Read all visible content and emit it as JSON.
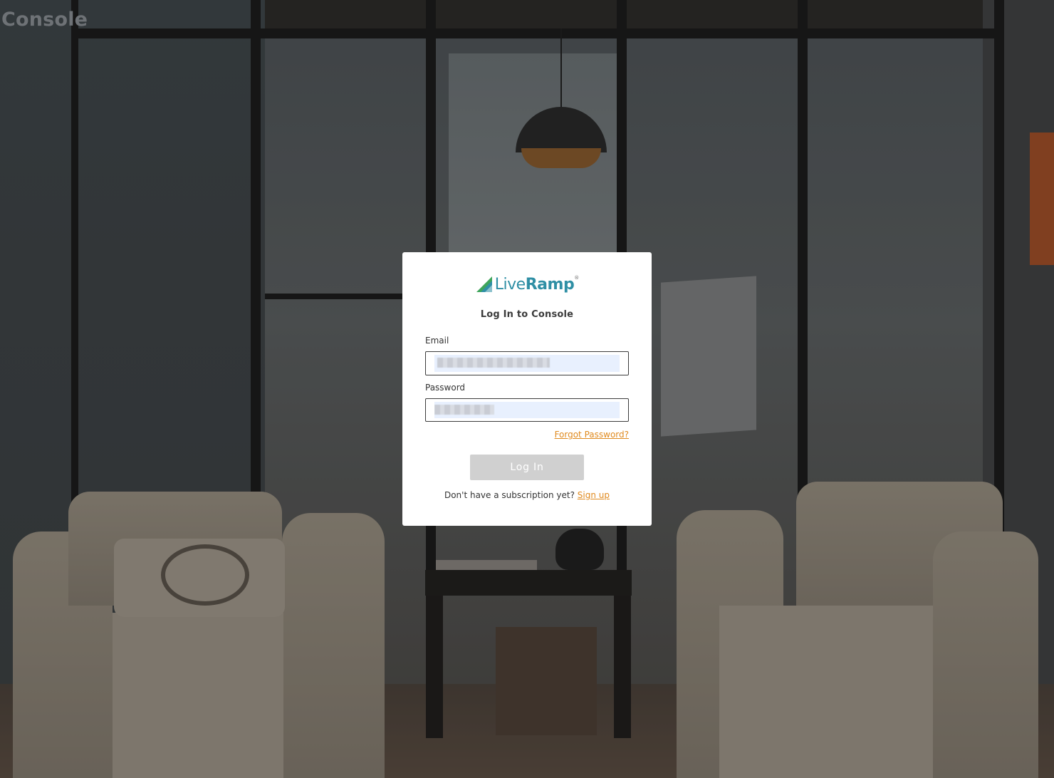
{
  "app": {
    "brand_title": "Console"
  },
  "login_card": {
    "logo_text_light": "Live",
    "logo_text_bold": "Ramp",
    "logo_trademark": "®",
    "title": "Log In to Console",
    "email_label": "Email",
    "email_value": "",
    "password_label": "Password",
    "password_value": "",
    "forgot_password_link": "Forgot Password?",
    "login_button": "Log In",
    "signup_prompt": "Don't have a subscription yet?",
    "signup_link": "Sign up"
  },
  "colors": {
    "accent_link": "#e08a1e",
    "logo_teal": "#2f8fa5",
    "logo_green": "#3ea45a",
    "button_disabled": "#d0d0d0",
    "autofill_fill": "#e8f0fe"
  },
  "icons": {
    "logo_mark": "liveramp-logo-icon"
  }
}
